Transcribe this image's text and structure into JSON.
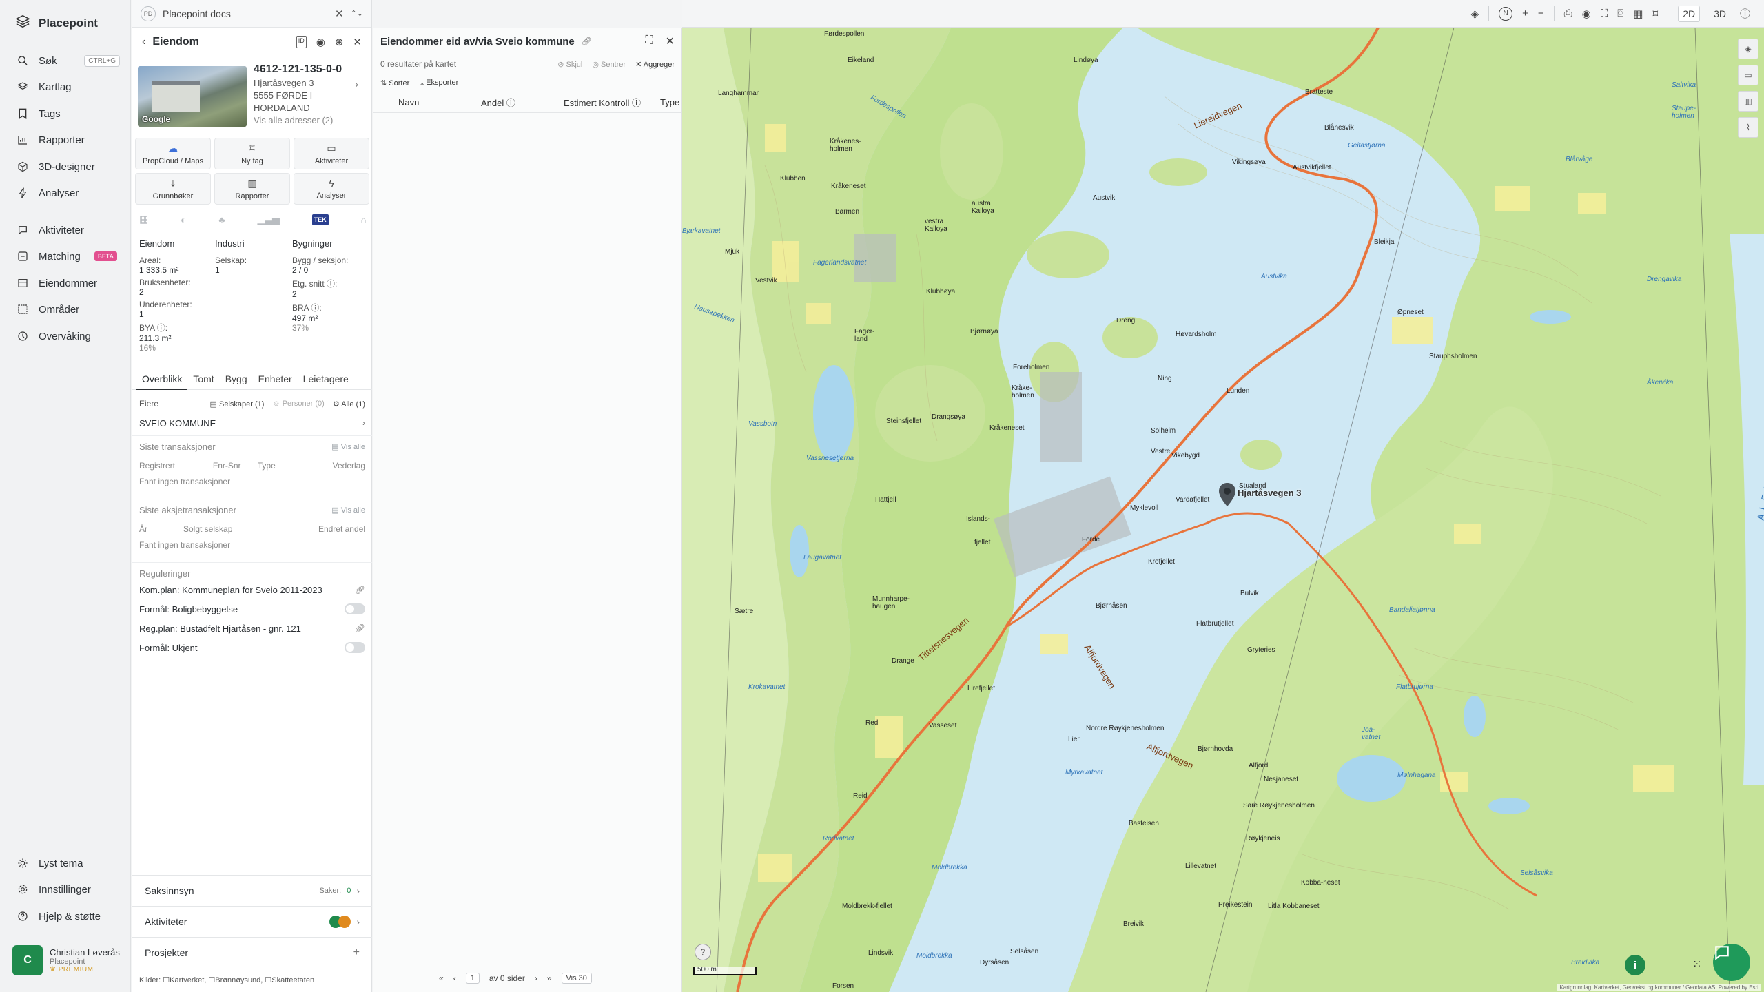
{
  "nav": {
    "brand": "Placepoint",
    "items": [
      {
        "label": "Søk",
        "icon": "search-icon",
        "shortcut": "CTRL+G"
      },
      {
        "label": "Kartlag",
        "icon": "layers-icon"
      },
      {
        "label": "Tags",
        "icon": "bookmark-icon"
      },
      {
        "label": "Rapporter",
        "icon": "chart-icon"
      },
      {
        "label": "3D-designer",
        "icon": "cube-icon"
      },
      {
        "label": "Analyser",
        "icon": "bolt-icon"
      },
      {
        "label": "Aktiviteter",
        "icon": "chat-icon"
      },
      {
        "label": "Matching",
        "icon": "match-icon",
        "badge": "BETA"
      },
      {
        "label": "Eiendommer",
        "icon": "property-icon"
      },
      {
        "label": "Områder",
        "icon": "area-icon"
      },
      {
        "label": "Overvåking",
        "icon": "eye-icon"
      }
    ],
    "bottom": [
      {
        "label": "Lyst tema",
        "icon": "sun-icon"
      },
      {
        "label": "Innstillinger",
        "icon": "gear-icon"
      },
      {
        "label": "Hjelp & støtte",
        "icon": "help-icon"
      }
    ],
    "user": {
      "initial": "C",
      "name": "Christian Løverås",
      "org": "Placepoint",
      "plan": "PREMIUM"
    }
  },
  "prop": {
    "tab_logo": "PD",
    "tab_title": "Placepoint docs",
    "title": "Eiendom",
    "pid": "4612-121-135-0-0",
    "address_lines": [
      "Hjartåsvegen 3",
      "5555 FØRDE I",
      "HORDALAND"
    ],
    "all_addresses": "Vis alle adresser (2)",
    "photo_label": "Google",
    "actions": [
      {
        "label": "PropCloud / Maps",
        "icon": "cloud-icon"
      },
      {
        "label": "Ny tag",
        "icon": "bookmark-icon"
      },
      {
        "label": "Aktiviteter",
        "icon": "chat-icon"
      },
      {
        "label": "Grunnbøker",
        "icon": "download-icon"
      },
      {
        "label": "Rapporter",
        "icon": "chart-icon"
      },
      {
        "label": "Analyser",
        "icon": "bolt-icon"
      }
    ],
    "tek": "TEK",
    "stats": {
      "col1": {
        "h": "Eiendom",
        "items": [
          [
            "Areal:",
            "1 333.5 m²"
          ],
          [
            "Bruksenheter:",
            "2"
          ],
          [
            "Underenheter:",
            "1"
          ],
          [
            "BYA ⓘ:",
            "211.3 m²"
          ],
          [
            "",
            "16%"
          ]
        ]
      },
      "col2": {
        "h": "Industri",
        "items": [
          [
            "Selskap:",
            "1"
          ]
        ]
      },
      "col3": {
        "h": "Bygninger",
        "items": [
          [
            "Bygg / seksjon:",
            "2 / 0"
          ],
          [
            "Etg. snitt ⓘ:",
            "2"
          ],
          [
            "BRA ⓘ:",
            "497 m²"
          ],
          [
            "",
            "37%"
          ]
        ]
      }
    },
    "tabs": [
      "Overblikk",
      "Tomt",
      "Bygg",
      "Enheter",
      "Leietagere"
    ],
    "owners": {
      "label": "Eiere",
      "filters": [
        "Selskaper (1)",
        "Personer (0)",
        "Alle (1)"
      ],
      "name": "SVEIO KOMMUNE"
    },
    "transactions": {
      "title": "Siste transaksjoner",
      "link": "Vis alle",
      "cols": [
        "Registrert",
        "Fnr-Snr",
        "Type",
        "Vederlag"
      ],
      "empty": "Fant ingen transaksjoner"
    },
    "share_tx": {
      "title": "Siste aksjetransaksjoner",
      "link": "Vis alle",
      "cols": [
        "År",
        "Solgt selskap",
        "Endret andel"
      ],
      "empty": "Fant ingen transaksjoner"
    },
    "regulations": {
      "title": "Reguleringer",
      "items": [
        {
          "label": "Kom.plan: Kommuneplan for Sveio 2011-2023",
          "kind": "link"
        },
        {
          "label": "Formål: Boligbebyggelse",
          "kind": "toggle"
        },
        {
          "label": "Reg.plan: Bustadfelt Hjartåsen - gnr. 121",
          "kind": "link"
        },
        {
          "label": "Formål: Ukjent",
          "kind": "toggle"
        }
      ]
    },
    "accordions": [
      {
        "label": "Saksinnsyn",
        "right": "Saker:",
        "count": "0"
      },
      {
        "label": "Aktiviteter",
        "right": ""
      },
      {
        "label": "Prosjekter",
        "right": "+"
      }
    ],
    "sources": {
      "label": "Kilder:",
      "items": [
        "Kartverket",
        "Brønnøysund",
        "Skatteetaten"
      ]
    }
  },
  "owners_panel": {
    "title": "Eiendommer eid av/via Sveio kommune",
    "results": "0 resultater på kartet",
    "hide": "Skjul",
    "center": "Sentrer",
    "aggregate": "Aggreger",
    "sort": "Sorter",
    "export": "Eksporter",
    "cols": [
      "Navn",
      "Andel ⓘ",
      "Estimert Kontroll ⓘ",
      "Type"
    ],
    "pager": {
      "page": "1",
      "of": "av 0 sider",
      "per": "Vis 30"
    }
  },
  "mapbar": {
    "dim2d": "2D",
    "dim3d": "3D"
  },
  "map": {
    "scale": "500 m",
    "attribution": "Kartgrunnlag: Kartverket, Geovekst og kommuner / Geodata AS. Powered by Esri",
    "pin_label": "Hjartåsvegen 3",
    "roads": [
      "Liereidvegen",
      "Tittelsnesvegen",
      "Alfjordvegen",
      "Alfjordvegen"
    ],
    "places": [
      "Førdespollen",
      "Eikeland",
      "Lindøya",
      "Langhammar",
      "Kråkenes-holmen",
      "Kråkeneset",
      "Klubben",
      "Barmen",
      "austra Kalloya",
      "vestra Kalloya",
      "Fagerlandsvatnet",
      "Vestvik",
      "Mjuk",
      "Klubbøya",
      "Fager-land",
      "Bjørnøya",
      "Foreholmen",
      "Kråke-holmen",
      "Kråkeneset",
      "Steinsfjellet",
      "Drangsøya",
      "Hattjell",
      "Islands-",
      "fjellet",
      "Forde",
      "Bjørnåsen",
      "Myklevoll",
      "Solheim",
      "Vestre",
      "Vikebygd",
      "Austvik",
      "Dreng",
      "Høvardsholm",
      "Lunden",
      "Ning",
      "Stualand",
      "Krofjellet",
      "Vardafjellet",
      "Bulvik",
      "Flatbrutjellet",
      "Gryteries",
      "Lirefjellet",
      "Vasseset",
      "Munnharpe-haugen",
      "Drange",
      "Sætre",
      "Red",
      "Reid",
      "Lier",
      "Nordre Røykjenesholmen",
      "Alfjord",
      "Nesjaneset",
      "Sare Røykjenesholmen",
      "Røykjeneis",
      "Bjørnhovda",
      "Basteisen",
      "Lillevatnet",
      "Moldbrekk-fjellet",
      "Moldbrekka",
      "Lindsvik",
      "Forsen",
      "Dyrsåsen",
      "Selsåsen",
      "Breivik",
      "Preikestein",
      "Litla Kobbaneset",
      "Kobba-neset",
      "Bleikja",
      "Øpneset",
      "Stauphsholmen",
      "Bratteste",
      "Blånesvik",
      "Austvikfjellet",
      "Vikingsøya"
    ],
    "waters": [
      "Fordespollen",
      "Bjarkavatnet",
      "Nausabekken",
      "Vassbotn",
      "Vassnesetjørna",
      "Laugavatnet",
      "Krokavatnet",
      "Rodvatnet",
      "Moldbrekka",
      "Austvika",
      "Drengavika",
      "Åkervika",
      "Saltvika",
      "Staupe-holmen",
      "Blårvåge",
      "Geitastjørna",
      "Bandaliatjønna",
      "Flatbrujørna",
      "Joa-vatnet",
      "Myrkavatnet",
      "Mølnhagana",
      "Selsåsvika",
      "Breidvika",
      "ALFJORDEN"
    ]
  }
}
